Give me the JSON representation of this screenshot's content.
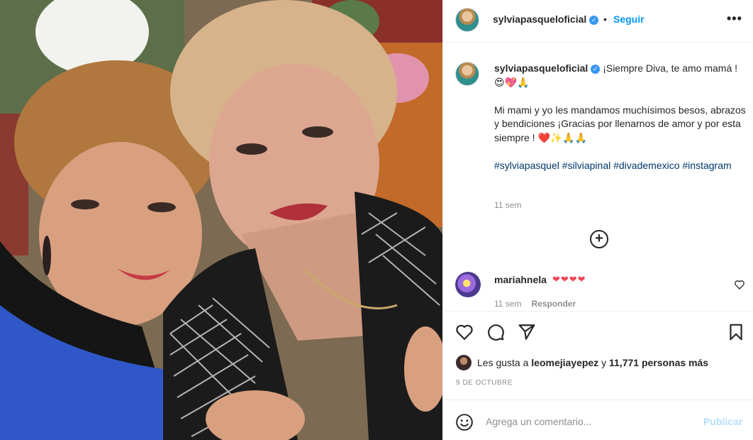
{
  "post": {
    "username": "sylviapasqueloficial",
    "verified_mark": "✓",
    "separator": "•",
    "follow_label": "Seguir",
    "more_label": "•••"
  },
  "caption": {
    "username": "sylviapasqueloficial",
    "line1": "¡Siempre Diva, te amo mamá !😍💖🙏",
    "line2": "Mi mami y yo les mandamos muchísimos besos, abrazos y bendiciones ¡Gracias por llenarnos de amor y por esta siempre ! ❤️✨🙏🙏",
    "hashtags": [
      "#sylviapasquel",
      "#silviapinal",
      "#divademexico",
      "#instagram"
    ],
    "time": "11 sem"
  },
  "load_more_icon": "plus-circle-icon",
  "comment": {
    "username": "mariahnela",
    "text": "❤❤❤❤",
    "time": "11 sem",
    "reply_label": "Responder"
  },
  "likes": {
    "prefix": "Les gusta a",
    "user": "leomejiayepez",
    "conjunction": "y",
    "count": "11,771 personas más"
  },
  "date": "9 DE OCTUBRE",
  "add_comment": {
    "placeholder": "Agrega un comentario...",
    "publish_label": "Publicar"
  },
  "icons": [
    "heart-icon",
    "comment-icon",
    "share-icon",
    "bookmark-icon",
    "emoji-icon",
    "more-icon"
  ],
  "colors": {
    "link_blue": "#0095f6",
    "hashtag": "#00376b",
    "muted": "#8e8e8e",
    "publish_disabled": "#b2dffc"
  }
}
